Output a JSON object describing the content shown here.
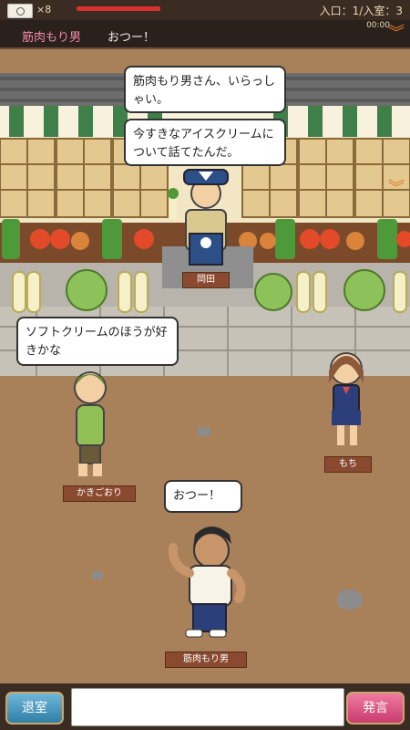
{
  "topbar": {
    "ticket_count": "×8",
    "room_status": "入口：1/入室：3"
  },
  "message_bar": {
    "speaker": "筋肉もり男",
    "text": "おつー！",
    "timer": "00:00"
  },
  "characters": [
    {
      "name": "岡田",
      "speech": [
        "筋肉もり男さん、いらっしゃい。",
        "今すきなアイスクリームについて話てたんだ。"
      ]
    },
    {
      "name": "かきごおり",
      "speech": [
        "ソフトクリームのほうが好きかな"
      ]
    },
    {
      "name": "もち",
      "speech": []
    },
    {
      "name": "筋肉もり男",
      "speech": [
        "おつー！"
      ]
    }
  ],
  "bottombar": {
    "exit_label": "退室",
    "say_label": "発言",
    "input_value": ""
  },
  "colors": {
    "ground": "#a8805a",
    "header_bg": "#2a211c",
    "speaker_pink": "#f08aa6",
    "exit_blue": "#2f7fa8",
    "say_pink": "#c83c6e"
  }
}
